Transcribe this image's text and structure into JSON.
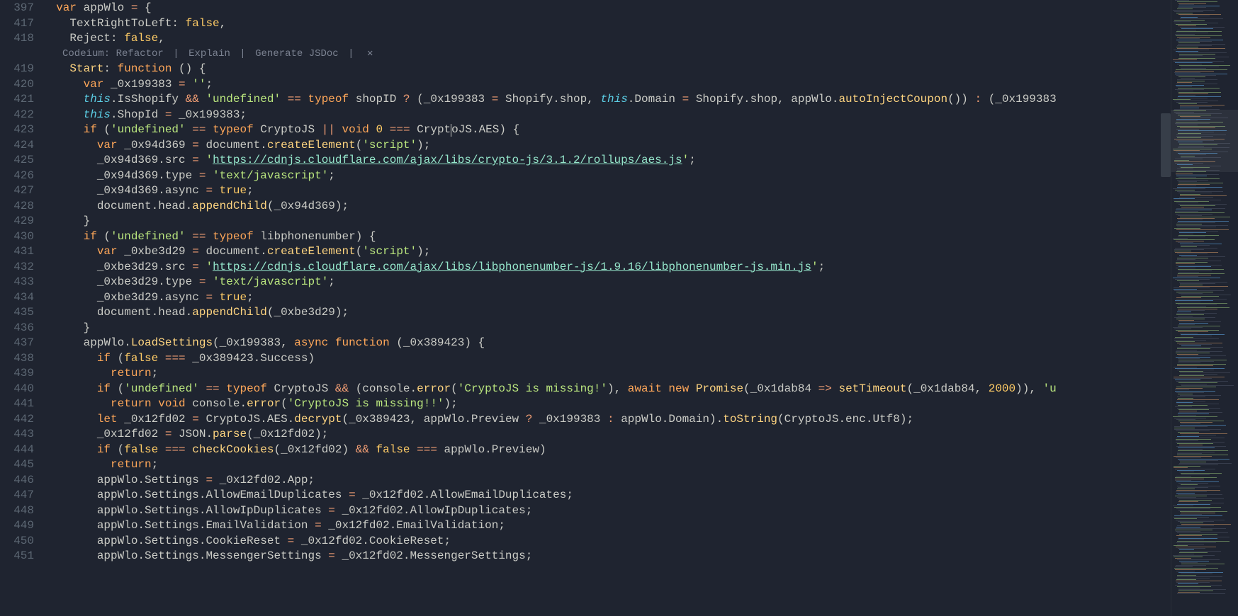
{
  "lineNumbers": [
    "397",
    "417",
    "418",
    "",
    "419",
    "420",
    "421",
    "422",
    "423",
    "424",
    "425",
    "426",
    "427",
    "428",
    "429",
    "430",
    "431",
    "432",
    "433",
    "434",
    "435",
    "436",
    "437",
    "438",
    "439",
    "440",
    "441",
    "442",
    "443",
    "444",
    "445",
    "446",
    "447",
    "448",
    "449",
    "450",
    "451"
  ],
  "codelens": {
    "prefix": "Codeium:",
    "refactor": "Refactor",
    "explain": "Explain",
    "generate": "Generate JSDoc",
    "close": "✕"
  },
  "bulbLine": 442,
  "lines": {
    "l397": {
      "ind": "  ",
      "t": [
        [
          "k",
          "var"
        ],
        [
          "p",
          " appWlo "
        ],
        [
          "op",
          "="
        ],
        [
          "p",
          " {"
        ]
      ]
    },
    "l417": {
      "ind": "    ",
      "t": [
        [
          "p",
          "TextRightToLeft: "
        ],
        [
          "b",
          "false"
        ],
        [
          "p",
          ","
        ]
      ]
    },
    "l418": {
      "ind": "    ",
      "t": [
        [
          "p",
          "Reject: "
        ],
        [
          "b",
          "false"
        ],
        [
          "p",
          ","
        ]
      ]
    },
    "l419": {
      "ind": "    ",
      "t": [
        [
          "fn",
          "Start"
        ],
        [
          "p",
          ": "
        ],
        [
          "k",
          "function"
        ],
        [
          "p",
          " () {"
        ]
      ]
    },
    "l420": {
      "ind": "      ",
      "t": [
        [
          "k",
          "var"
        ],
        [
          "p",
          " _0x199383 "
        ],
        [
          "op",
          "="
        ],
        [
          "p",
          " "
        ],
        [
          "s",
          "''"
        ],
        [
          "p",
          ";"
        ]
      ]
    },
    "l421": {
      "ind": "      ",
      "t": [
        [
          "th",
          "this"
        ],
        [
          "p",
          ".IsShopify "
        ],
        [
          "op",
          "&&"
        ],
        [
          "p",
          " "
        ],
        [
          "s",
          "'undefined'"
        ],
        [
          "p",
          " "
        ],
        [
          "op",
          "=="
        ],
        [
          "p",
          " "
        ],
        [
          "k",
          "typeof"
        ],
        [
          "p",
          " shopID "
        ],
        [
          "op",
          "?"
        ],
        [
          "p",
          " (_0x199383 "
        ],
        [
          "op",
          "="
        ],
        [
          "p",
          " Shopify.shop, "
        ],
        [
          "th",
          "this"
        ],
        [
          "p",
          ".Domain "
        ],
        [
          "op",
          "="
        ],
        [
          "p",
          " Shopify.shop, appWlo."
        ],
        [
          "fn",
          "autoInjectCoupon"
        ],
        [
          "p",
          "()) "
        ],
        [
          "op",
          ":"
        ],
        [
          "p",
          " (_0x199383"
        ]
      ]
    },
    "l422": {
      "ind": "      ",
      "t": [
        [
          "th",
          "this"
        ],
        [
          "p",
          ".ShopId "
        ],
        [
          "op",
          "="
        ],
        [
          "p",
          " _0x199383;"
        ]
      ]
    },
    "l423": {
      "ind": "      ",
      "t": [
        [
          "k",
          "if"
        ],
        [
          "p",
          " ("
        ],
        [
          "s",
          "'undefined'"
        ],
        [
          "p",
          " "
        ],
        [
          "op",
          "=="
        ],
        [
          "p",
          " "
        ],
        [
          "k",
          "typeof"
        ],
        [
          "p",
          " CryptoJS "
        ],
        [
          "op",
          "||"
        ],
        [
          "p",
          " "
        ],
        [
          "k",
          "void"
        ],
        [
          "p",
          " "
        ],
        [
          "n",
          "0"
        ],
        [
          "p",
          " "
        ],
        [
          "op",
          "==="
        ],
        [
          "p",
          " Crypt"
        ],
        [
          "cur",
          ""
        ],
        [
          "p",
          "oJS.AES) {"
        ]
      ]
    },
    "l424": {
      "ind": "        ",
      "t": [
        [
          "k",
          "var"
        ],
        [
          "p",
          " _0x94d369 "
        ],
        [
          "op",
          "="
        ],
        [
          "p",
          " document."
        ],
        [
          "fn",
          "createElement"
        ],
        [
          "p",
          "("
        ],
        [
          "s",
          "'script'"
        ],
        [
          "p",
          ");"
        ]
      ]
    },
    "l425": {
      "ind": "        ",
      "t": [
        [
          "p",
          "_0x94d369.src "
        ],
        [
          "op",
          "="
        ],
        [
          "p",
          " "
        ],
        [
          "s",
          "'"
        ],
        [
          "u",
          "https://cdnjs.cloudflare.com/ajax/libs/crypto-js/3.1.2/rollups/aes.js"
        ],
        [
          "s",
          "'"
        ],
        [
          "p",
          ";"
        ]
      ]
    },
    "l426": {
      "ind": "        ",
      "t": [
        [
          "p",
          "_0x94d369.type "
        ],
        [
          "op",
          "="
        ],
        [
          "p",
          " "
        ],
        [
          "s",
          "'text/javascript'"
        ],
        [
          "p",
          ";"
        ]
      ]
    },
    "l427": {
      "ind": "        ",
      "t": [
        [
          "p",
          "_0x94d369.async "
        ],
        [
          "op",
          "="
        ],
        [
          "p",
          " "
        ],
        [
          "b",
          "true"
        ],
        [
          "p",
          ";"
        ]
      ]
    },
    "l428": {
      "ind": "        ",
      "t": [
        [
          "p",
          "document.head."
        ],
        [
          "fn",
          "appendChild"
        ],
        [
          "p",
          "(_0x94d369);"
        ]
      ]
    },
    "l429": {
      "ind": "      ",
      "t": [
        [
          "p",
          "}"
        ]
      ]
    },
    "l430": {
      "ind": "      ",
      "t": [
        [
          "k",
          "if"
        ],
        [
          "p",
          " ("
        ],
        [
          "s",
          "'undefined'"
        ],
        [
          "p",
          " "
        ],
        [
          "op",
          "=="
        ],
        [
          "p",
          " "
        ],
        [
          "k",
          "typeof"
        ],
        [
          "p",
          " libphonenumber) {"
        ]
      ]
    },
    "l431": {
      "ind": "        ",
      "t": [
        [
          "k",
          "var"
        ],
        [
          "p",
          " _0xbe3d29 "
        ],
        [
          "op",
          "="
        ],
        [
          "p",
          " document."
        ],
        [
          "fn",
          "createElement"
        ],
        [
          "p",
          "("
        ],
        [
          "s",
          "'script'"
        ],
        [
          "p",
          ");"
        ]
      ]
    },
    "l432": {
      "ind": "        ",
      "t": [
        [
          "p",
          "_0xbe3d29.src "
        ],
        [
          "op",
          "="
        ],
        [
          "p",
          " "
        ],
        [
          "s",
          "'"
        ],
        [
          "u",
          "https://cdnjs.cloudflare.com/ajax/libs/libphonenumber-js/1.9.16/libphonenumber-js.min.js"
        ],
        [
          "s",
          "'"
        ],
        [
          "p",
          ";"
        ]
      ]
    },
    "l433": {
      "ind": "        ",
      "t": [
        [
          "p",
          "_0xbe3d29.type "
        ],
        [
          "op",
          "="
        ],
        [
          "p",
          " "
        ],
        [
          "s",
          "'text/javascript'"
        ],
        [
          "p",
          ";"
        ]
      ]
    },
    "l434": {
      "ind": "        ",
      "t": [
        [
          "p",
          "_0xbe3d29.async "
        ],
        [
          "op",
          "="
        ],
        [
          "p",
          " "
        ],
        [
          "b",
          "true"
        ],
        [
          "p",
          ";"
        ]
      ]
    },
    "l435": {
      "ind": "        ",
      "t": [
        [
          "p",
          "document.head."
        ],
        [
          "fn",
          "appendChild"
        ],
        [
          "p",
          "(_0xbe3d29);"
        ]
      ]
    },
    "l436": {
      "ind": "      ",
      "t": [
        [
          "p",
          "}"
        ]
      ]
    },
    "l437": {
      "ind": "      ",
      "t": [
        [
          "p",
          "appWlo."
        ],
        [
          "fn",
          "LoadSettings"
        ],
        [
          "p",
          "(_0x199383, "
        ],
        [
          "k",
          "async"
        ],
        [
          "p",
          " "
        ],
        [
          "k",
          "function"
        ],
        [
          "p",
          " (_0x389423) {"
        ]
      ]
    },
    "l438": {
      "ind": "        ",
      "t": [
        [
          "k",
          "if"
        ],
        [
          "p",
          " ("
        ],
        [
          "b",
          "false"
        ],
        [
          "p",
          " "
        ],
        [
          "op",
          "==="
        ],
        [
          "p",
          " _0x389423.Success)"
        ]
      ]
    },
    "l439": {
      "ind": "          ",
      "t": [
        [
          "k",
          "return"
        ],
        [
          "p",
          ";"
        ]
      ]
    },
    "l440": {
      "ind": "        ",
      "t": [
        [
          "k",
          "if"
        ],
        [
          "p",
          " ("
        ],
        [
          "s",
          "'undefined'"
        ],
        [
          "p",
          " "
        ],
        [
          "op",
          "=="
        ],
        [
          "p",
          " "
        ],
        [
          "k",
          "typeof"
        ],
        [
          "p",
          " CryptoJS "
        ],
        [
          "op",
          "&&"
        ],
        [
          "p",
          " (console."
        ],
        [
          "fn",
          "error"
        ],
        [
          "p",
          "("
        ],
        [
          "s",
          "'CryptoJS is missing!'"
        ],
        [
          "p",
          "), "
        ],
        [
          "k",
          "await"
        ],
        [
          "p",
          " "
        ],
        [
          "k",
          "new"
        ],
        [
          "p",
          " "
        ],
        [
          "fn",
          "Promise"
        ],
        [
          "p",
          "(_0x1dab84 "
        ],
        [
          "op",
          "=>"
        ],
        [
          "p",
          " "
        ],
        [
          "fn",
          "setTimeout"
        ],
        [
          "p",
          "(_0x1dab84, "
        ],
        [
          "n",
          "2000"
        ],
        [
          "p",
          ")), "
        ],
        [
          "s",
          "'u"
        ]
      ]
    },
    "l441": {
      "ind": "          ",
      "t": [
        [
          "k",
          "return"
        ],
        [
          "p",
          " "
        ],
        [
          "k",
          "void"
        ],
        [
          "p",
          " console."
        ],
        [
          "fn",
          "error"
        ],
        [
          "p",
          "("
        ],
        [
          "s",
          "'CryptoJS is missing!!'"
        ],
        [
          "p",
          ");"
        ]
      ]
    },
    "l442": {
      "ind": "        ",
      "t": [
        [
          "k",
          "let"
        ],
        [
          "p",
          " _0x12fd02 "
        ],
        [
          "op",
          "="
        ],
        [
          "p",
          " CryptoJS.AES."
        ],
        [
          "fn",
          "decrypt"
        ],
        [
          "p",
          "(_0x389423, appWlo.Preview "
        ],
        [
          "op",
          "?"
        ],
        [
          "p",
          " _0x199383 "
        ],
        [
          "op",
          ":"
        ],
        [
          "p",
          " appWlo.Domain)."
        ],
        [
          "fn",
          "toString"
        ],
        [
          "p",
          "(CryptoJS.enc.Utf8);"
        ]
      ]
    },
    "l443": {
      "ind": "        ",
      "t": [
        [
          "p",
          "_0x12fd02 "
        ],
        [
          "op",
          "="
        ],
        [
          "p",
          " JSON."
        ],
        [
          "fn",
          "parse"
        ],
        [
          "p",
          "(_0x12fd02);"
        ]
      ]
    },
    "l444": {
      "ind": "        ",
      "t": [
        [
          "k",
          "if"
        ],
        [
          "p",
          " ("
        ],
        [
          "b",
          "false"
        ],
        [
          "p",
          " "
        ],
        [
          "op",
          "==="
        ],
        [
          "p",
          " "
        ],
        [
          "fn",
          "checkCookies"
        ],
        [
          "p",
          "(_0x12fd02) "
        ],
        [
          "op",
          "&&"
        ],
        [
          "p",
          " "
        ],
        [
          "b",
          "false"
        ],
        [
          "p",
          " "
        ],
        [
          "op",
          "==="
        ],
        [
          "p",
          " appWlo.Preview)"
        ]
      ]
    },
    "l445": {
      "ind": "          ",
      "t": [
        [
          "k",
          "return"
        ],
        [
          "p",
          ";"
        ]
      ]
    },
    "l446": {
      "ind": "        ",
      "t": [
        [
          "p",
          "appWlo.Settings "
        ],
        [
          "op",
          "="
        ],
        [
          "p",
          " _0x12fd02.App;"
        ]
      ]
    },
    "l447": {
      "ind": "        ",
      "t": [
        [
          "p",
          "appWlo.Settings.AllowEmailDuplicates "
        ],
        [
          "op",
          "="
        ],
        [
          "p",
          " _0x12fd02.AllowEmailDuplicates;"
        ]
      ]
    },
    "l448": {
      "ind": "        ",
      "t": [
        [
          "p",
          "appWlo.Settings.AllowIpDuplicates "
        ],
        [
          "op",
          "="
        ],
        [
          "p",
          " _0x12fd02.AllowIpDuplicates;"
        ]
      ]
    },
    "l449": {
      "ind": "        ",
      "t": [
        [
          "p",
          "appWlo.Settings.EmailValidation "
        ],
        [
          "op",
          "="
        ],
        [
          "p",
          " _0x12fd02.EmailValidation;"
        ]
      ]
    },
    "l450": {
      "ind": "        ",
      "t": [
        [
          "p",
          "appWlo.Settings.CookieReset "
        ],
        [
          "op",
          "="
        ],
        [
          "p",
          " _0x12fd02.CookieReset;"
        ]
      ]
    },
    "l451": {
      "ind": "        ",
      "t": [
        [
          "p",
          "appWlo.Settings.MessengerSettings "
        ],
        [
          "op",
          "="
        ],
        [
          "p",
          " _0x12fd02.MessengerSettings;"
        ]
      ]
    }
  }
}
